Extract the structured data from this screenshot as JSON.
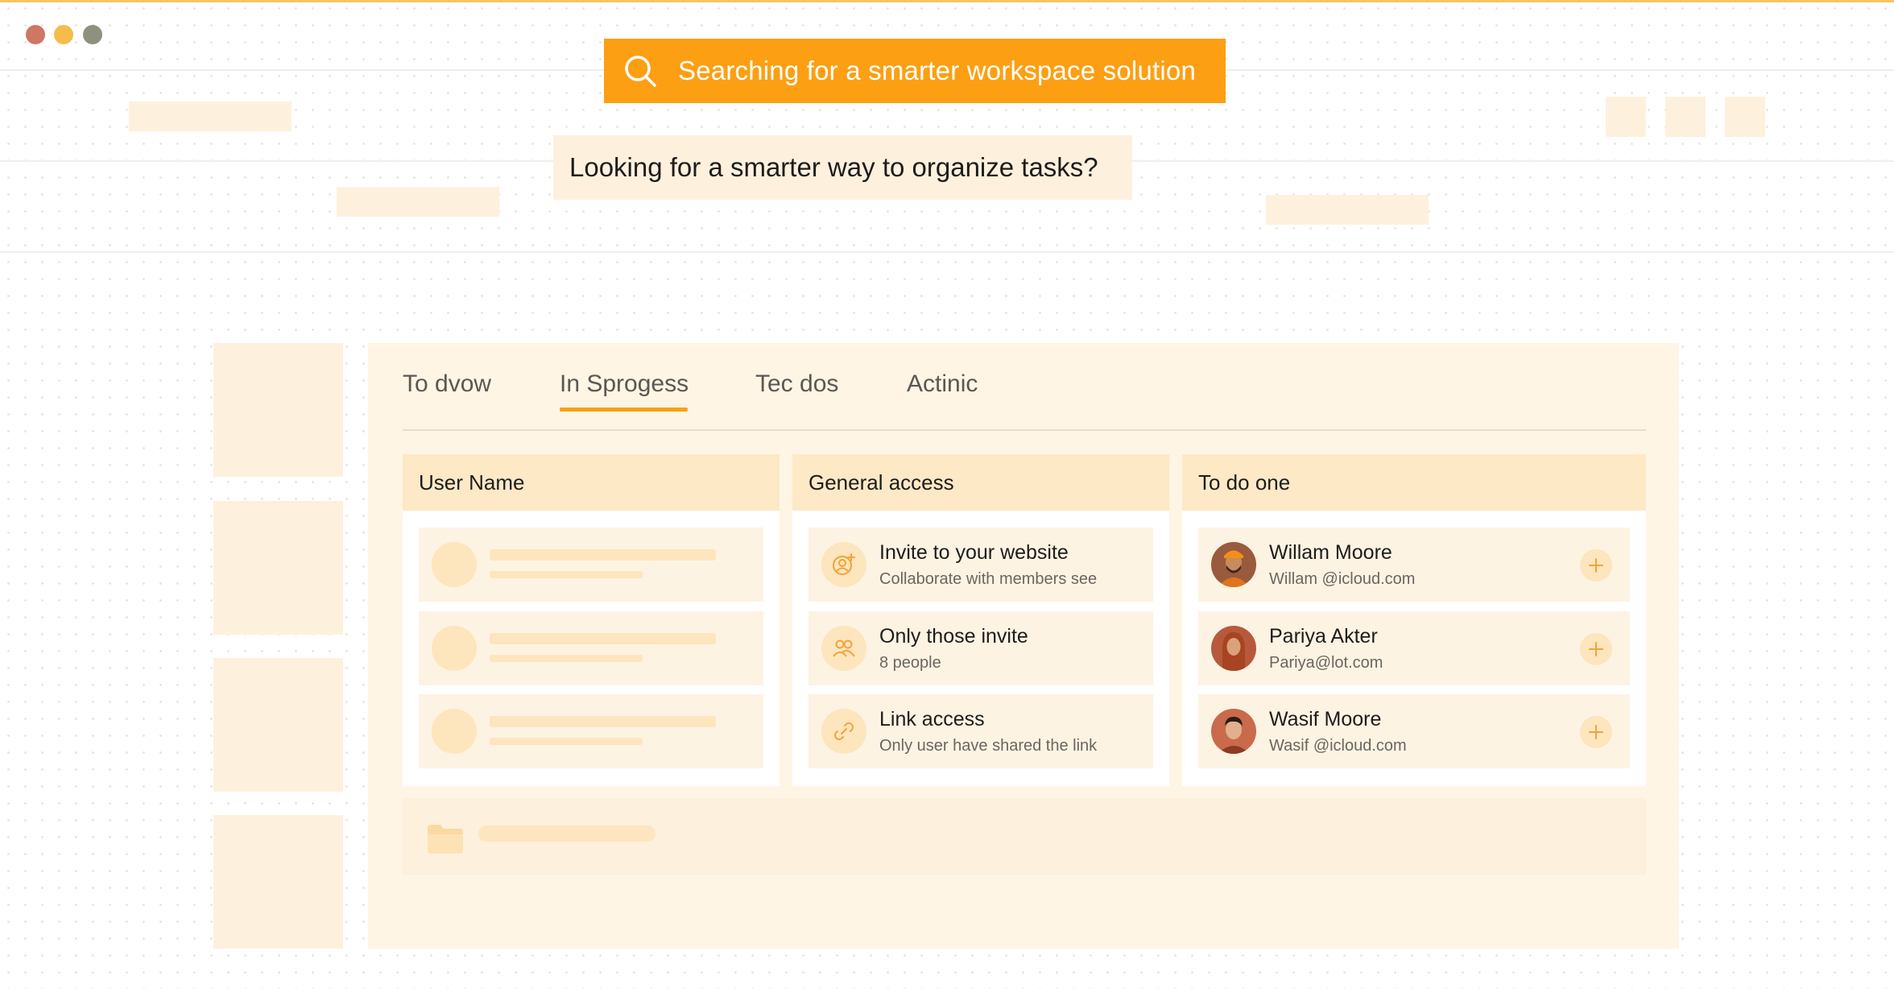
{
  "search": {
    "text": "Searching for a smarter workspace solution",
    "icon": "search-icon"
  },
  "tooltip": {
    "text": "Looking for a smarter way to organize tasks?"
  },
  "tabs": [
    {
      "label": "To dvow",
      "active": false
    },
    {
      "label": "In Sprogess",
      "active": true
    },
    {
      "label": "Tec dos",
      "active": false
    },
    {
      "label": "Actinic",
      "active": false
    }
  ],
  "columns": {
    "user_name": {
      "header": "User Name"
    },
    "general_access": {
      "header": "General access",
      "items": [
        {
          "title": "Invite to your website",
          "subtitle": "Collaborate with members see",
          "icon": "user-plus-icon"
        },
        {
          "title": "Only those invite",
          "subtitle": "8 people",
          "icon": "users-icon"
        },
        {
          "title": "Link access",
          "subtitle": "Only user have shared the link",
          "icon": "link-icon"
        }
      ]
    },
    "todo": {
      "header": "To do one",
      "people": [
        {
          "name": "Willam Moore",
          "email": "Willam @icloud.com"
        },
        {
          "name": "Pariya Akter",
          "email": "Pariya@lot.com"
        },
        {
          "name": "Wasif Moore",
          "email": "Wasif @icloud.com"
        }
      ]
    }
  },
  "colors": {
    "accent": "#fd9f13",
    "panel": "#fef5e4",
    "header": "#fde9c6",
    "traffic_red": "#cf7664",
    "traffic_yellow": "#f7bb4c",
    "traffic_gray": "#8e917c"
  }
}
